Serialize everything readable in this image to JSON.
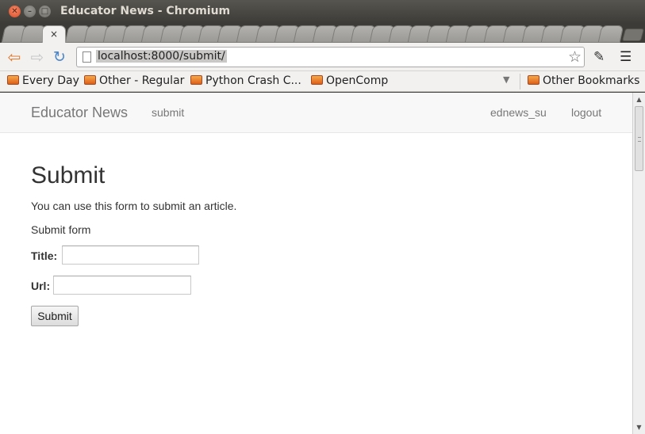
{
  "window": {
    "title": "Educator News - Chromium"
  },
  "tabs": {
    "close_glyph": "×"
  },
  "toolbar": {
    "url": "localhost:8000/submit/"
  },
  "bookmarks": {
    "items": [
      {
        "label": "Every Day"
      },
      {
        "label": "Other - Regular"
      },
      {
        "label": "Python Crash C..."
      },
      {
        "label": "OpenComp"
      }
    ],
    "other": "Other Bookmarks"
  },
  "site_nav": {
    "brand": "Educator News",
    "submit_link": "submit",
    "user_link": "ednews_su",
    "logout_link": "logout"
  },
  "page": {
    "heading": "Submit",
    "intro": "You can use this form to submit an article.",
    "form_caption": "Submit form",
    "title_label": "Title:",
    "title_value": "",
    "url_label": "Url:",
    "url_value": "",
    "submit_label": "Submit"
  },
  "colors": {
    "accent_back": "#e07a2e",
    "reload": "#4a86c8",
    "folder": "#dd5f18"
  }
}
